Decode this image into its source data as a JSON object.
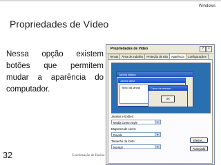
{
  "header": {
    "os_label": "Windows"
  },
  "slide": {
    "title": "Propriedades de Vídeo",
    "text": "Nessa opção existem botões que permitem mudar a aparência do computador.",
    "page_number": "32",
    "footer": "Coordenação de Ensino"
  },
  "dialog": {
    "title": "Propriedades de Vídeo",
    "help_label": "?",
    "close_label": "×",
    "tabs": [
      {
        "label": "Temas",
        "active": false
      },
      {
        "label": "Área de trabalho",
        "active": false
      },
      {
        "label": "Proteção de tela",
        "active": false
      },
      {
        "label": "Aparência",
        "active": true
      },
      {
        "label": "Configurações",
        "active": false
      }
    ],
    "preview": {
      "inactive_window_title": "Janela inativa",
      "active_window_title": "Janela ativa",
      "window_text": "Texto da janela",
      "message_box_title": "Caixa de mensa...",
      "ok_label": "OK"
    },
    "fields": {
      "windows_buttons_label": "Janelas e botões:",
      "windows_buttons_value": "Media Center style",
      "color_scheme_label": "Esquema de cores:",
      "color_scheme_value": "Royale",
      "font_size_label": "Tamanho da fonte:",
      "font_size_value": "Normal"
    },
    "buttons": {
      "effects": "Efeitos...",
      "advanced": "Avançada"
    }
  }
}
